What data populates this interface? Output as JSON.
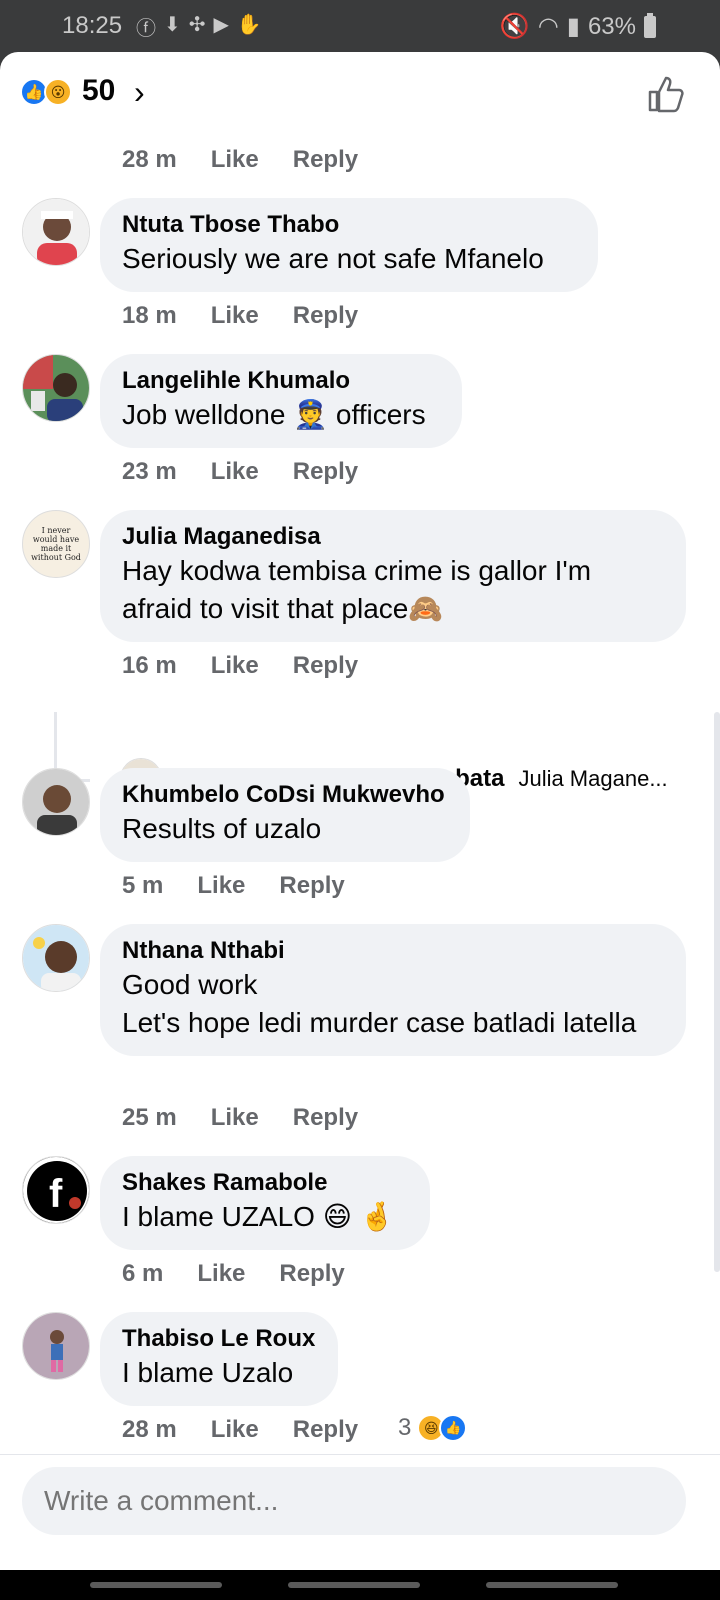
{
  "status": {
    "time": "18:25",
    "battery": "63%"
  },
  "reactions": {
    "count": "50"
  },
  "top_meta": {
    "time": "28 m",
    "like": "Like",
    "reply": "Reply"
  },
  "comments": [
    {
      "name": "Ntuta Tbose Thabo",
      "text": "Seriously we are not safe Mfanelo",
      "time": "18 m",
      "like": "Like",
      "reply": "Reply"
    },
    {
      "name": "Langelihle Khumalo",
      "text": "Job welldone 👮 officers",
      "time": "23 m",
      "like": "Like",
      "reply": "Reply"
    },
    {
      "name": "Julia Maganedisa",
      "text": "Hay kodwa tembisa crime is gallor I'm afraid to visit that place🙈",
      "time": "16 m",
      "like": "Like",
      "reply": "Reply",
      "avatar_text": "I never would have made it without God"
    },
    {
      "name": "Khumbelo CoDsi Mukwevho",
      "text": "Results of uzalo",
      "time": "5 m",
      "like": "Like",
      "reply": "Reply"
    },
    {
      "name": "Nthana Nthabi",
      "text": "Good work\nLet's hope ledi murder case batladi latella",
      "time": "25 m",
      "like": "Like",
      "reply": "Reply"
    },
    {
      "name": "Shakes Ramabole",
      "text": "I blame UZALO 😄 🤞",
      "time": "6 m",
      "like": "Like",
      "reply": "Reply"
    },
    {
      "name": "Thabiso Le Roux",
      "text": "I blame Uzalo",
      "time": "28 m",
      "like": "Like",
      "reply": "Reply",
      "reaction_count": "3"
    }
  ],
  "reply_preview": {
    "name": "Bambata Bongwe's Bambata",
    "text": "Julia Magane..."
  },
  "composer": {
    "placeholder": "Write a comment..."
  },
  "colors": {
    "accent": "#1877f2",
    "bubble": "#f0f2f5",
    "meta": "#65676b"
  }
}
